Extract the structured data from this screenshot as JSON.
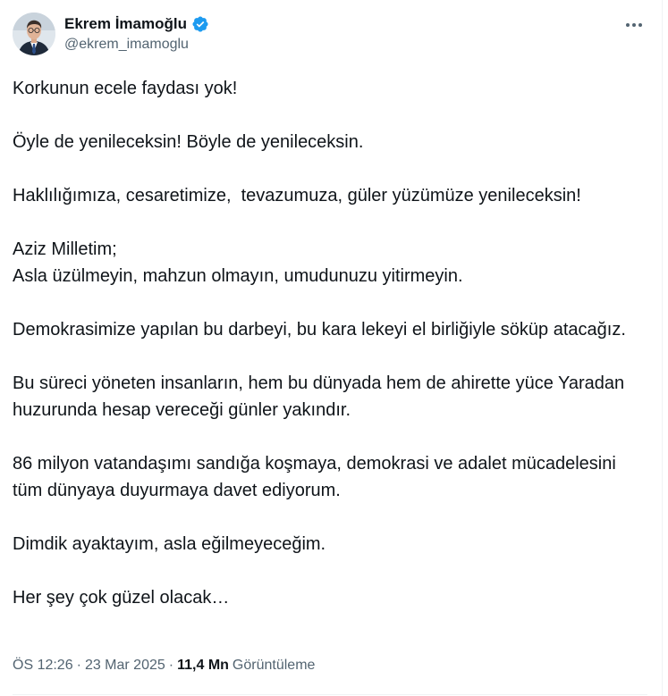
{
  "author": {
    "display_name": "Ekrem İmamoğlu",
    "handle": "@ekrem_imamoglu",
    "verified": true,
    "verified_color": "#1d9bf0"
  },
  "tweet": {
    "paragraphs": [
      "Korkunun ecele faydası yok!",
      "Öyle de yenileceksin! Böyle de yenileceksin.",
      "Haklılığımıza, cesaretimize,  tevazumuza, güler yüzümüze yenileceksin!",
      "Aziz Milletim;\nAsla üzülmeyin, mahzun olmayın, umudunuzu yitirmeyin.",
      "Demokrasimize yapılan bu darbeyi, bu kara lekeyi el birliğiyle söküp atacağız.",
      "Bu süreci yöneten insanların, hem bu dünyada hem de ahirette yüce Yaradan huzurunda hesap vereceği günler yakındır.",
      "86 milyon vatandaşımı sandığa koşmaya, demokrasi ve adalet mücadelesini tüm dünyaya duyurmaya davet ediyorum.",
      "Dimdik ayaktayım, asla eğilmeyeceğim.",
      "Her şey çok güzel olacak…"
    ]
  },
  "meta": {
    "time": "ÖS 12:26",
    "separator": "·",
    "date": "23 Mar 2025",
    "views_count": "11,4 Mn",
    "views_label": "Görüntüleme"
  },
  "icons": {
    "verified": "verified-badge-icon",
    "more": "more-horizontal-icon"
  }
}
